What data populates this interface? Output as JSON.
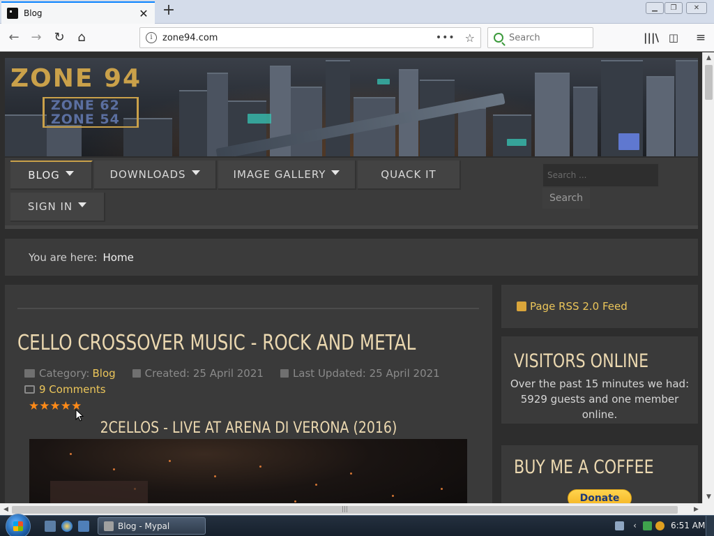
{
  "browser": {
    "tab_title": "Blog",
    "url": "zone94.com",
    "search_placeholder": "Search"
  },
  "site": {
    "logo_main": "ZONE 94",
    "logo_sub1": "ZONE 62",
    "logo_sub2": "ZONE 54",
    "menu": [
      {
        "label": "BLOG"
      },
      {
        "label": "DOWNLOADS"
      },
      {
        "label": "IMAGE GALLERY"
      },
      {
        "label": "QUACK IT"
      },
      {
        "label": "SIGN IN"
      }
    ],
    "search_placeholder": "Search ...",
    "search_button": "Search",
    "breadcrumb_label": "You are here:",
    "breadcrumb_home": "Home"
  },
  "article": {
    "title": "CELLO CROSSOVER MUSIC - ROCK AND METAL",
    "category_label": "Category:",
    "category": "Blog",
    "created": "Created: 25 April 2021",
    "updated": "Last Updated: 25 April 2021",
    "comments": "9 Comments",
    "rating_stars": 5,
    "stars_text": "★★★★★",
    "subtitle": "2CELLOS - LIVE AT ARENA DI VERONA (2016)"
  },
  "sidebar": {
    "rss_label": "Page RSS 2.0 Feed",
    "visitors_title": "VISITORS ONLINE",
    "visitors_text": "Over the past 15 minutes we had: 5929 guests and one member online.",
    "coffee_title": "BUY ME A COFFEE",
    "donate_label": "Donate"
  },
  "taskbar": {
    "task_label": "Blog - Mypal",
    "clock": "6:51 AM"
  },
  "colors": {
    "accent_gold": "#ecc65a",
    "title_cream": "#ebd8b0",
    "star_orange": "#ff8a18",
    "panel_bg": "#3a3a3a"
  }
}
